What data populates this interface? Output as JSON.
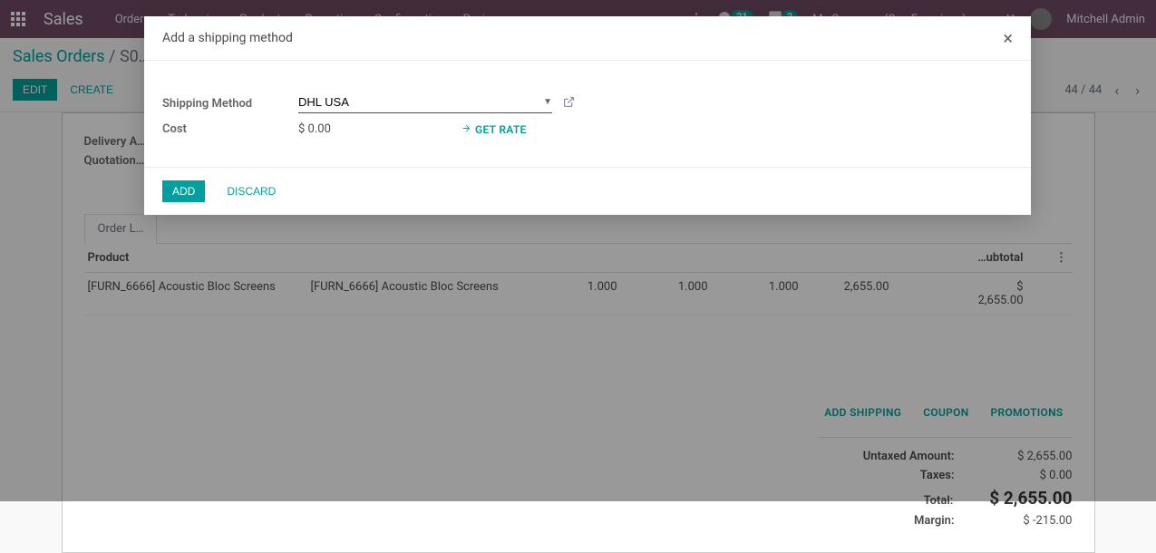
{
  "nav": {
    "brand": "Sales",
    "menu": [
      "Orders",
      "To Invoice",
      "Products",
      "Reporting",
      "Configuration",
      "Reviews"
    ],
    "company": "My Company (San Francisco)",
    "user": "Mitchell Admin",
    "badge_msgs": "21",
    "badge_activity": "2"
  },
  "breadcrumb": {
    "root": "Sales Orders",
    "sep": "/",
    "current": "S0…"
  },
  "buttons": {
    "edit": "EDIT",
    "create": "CREATE"
  },
  "pager": {
    "text": "44 / 44"
  },
  "form": {
    "delivery_label": "Delivery A…",
    "quotation_label": "Quotation…"
  },
  "tabs": {
    "order_lines": "Order L…"
  },
  "table": {
    "headers": {
      "product": "Product",
      "subtotal": "…ubtotal"
    },
    "rows": [
      {
        "product": "[FURN_6666] Acoustic Bloc Screens",
        "description": "[FURN_6666] Acoustic Bloc Screens",
        "qty": "1.000",
        "qty2": "1.000",
        "qty3": "1.000",
        "price": "2,655.00",
        "subtotal": "$ 2,655.00"
      }
    ]
  },
  "actions": {
    "add_shipping": "ADD SHIPPING",
    "coupon": "COUPON",
    "promotions": "PROMOTIONS"
  },
  "totals": {
    "untaxed_label": "Untaxed Amount:",
    "untaxed_val": "$ 2,655.00",
    "taxes_label": "Taxes:",
    "taxes_val": "$ 0.00",
    "total_label": "Total:",
    "total_val": "$ 2,655.00",
    "margin_label": "Margin:",
    "margin_val": "$ -215.00"
  },
  "modal": {
    "title": "Add a shipping method",
    "shipping_label": "Shipping Method",
    "shipping_value": "DHL USA",
    "cost_label": "Cost",
    "cost_value": "$ 0.00",
    "get_rate": "GET RATE",
    "add": "ADD",
    "discard": "DISCARD"
  }
}
